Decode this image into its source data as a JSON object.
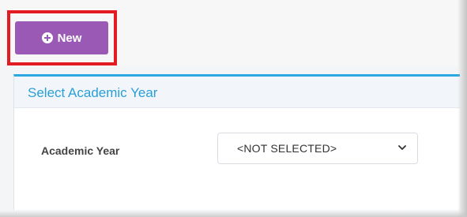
{
  "toolbar": {
    "new_button_label": "New",
    "new_button_icon": "plus-circle-icon",
    "highlight_color": "#e41b23",
    "button_color": "#9b59b6"
  },
  "panel": {
    "title": "Select Academic Year",
    "accent_color": "#2ba8e0",
    "fields": [
      {
        "label": "Academic Year",
        "selected_value": "<NOT SELECTED>"
      }
    ]
  }
}
